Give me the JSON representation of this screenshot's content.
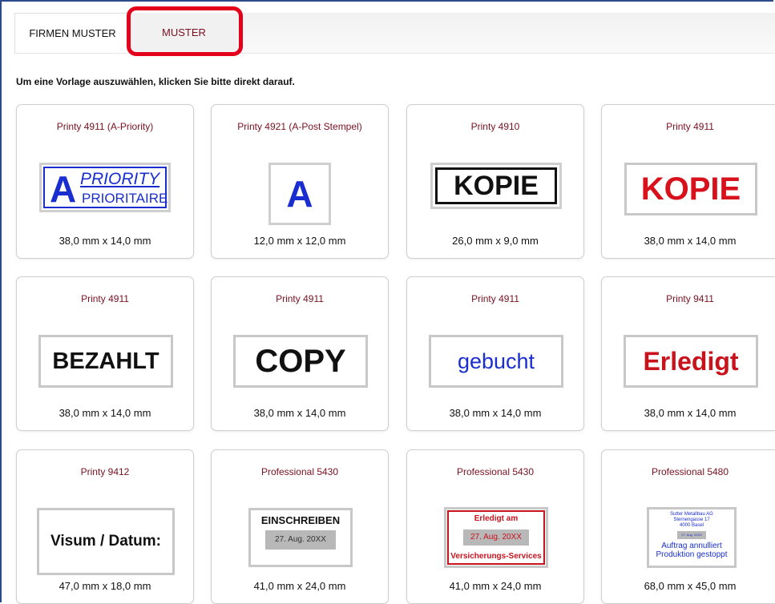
{
  "tabs": [
    {
      "label": "FIRMEN MUSTER"
    },
    {
      "label": "MUSTER"
    }
  ],
  "hint": "Um eine Vorlage auszuwählen, klicken Sie bitte direkt darauf.",
  "colors": {
    "accent": "#7a1020",
    "highlight": "#e4001b",
    "frame": "#2b4a8c",
    "blue": "#1a2ed0",
    "red": "#d8121c"
  },
  "cards": [
    {
      "title": "Printy 4911 (A-Priority)",
      "size": "38,0 mm x 14,0 mm",
      "stamp": {
        "big": "A",
        "line1": "PRIORITY",
        "line2": "PRIORITAIRE"
      }
    },
    {
      "title": "Printy 4921 (A-Post Stempel)",
      "size": "12,0 mm x 12,0 mm",
      "stamp": {
        "text": "A"
      }
    },
    {
      "title": "Printy 4910",
      "size": "26,0 mm x 9,0 mm",
      "stamp": {
        "text": "KOPIE"
      }
    },
    {
      "title": "Printy 4911",
      "size": "38,0 mm x 14,0 mm",
      "stamp": {
        "text": "KOPIE"
      }
    },
    {
      "title": "Printy 4911",
      "size": "38,0 mm x 14,0 mm",
      "stamp": {
        "text": "BEZAHLT"
      }
    },
    {
      "title": "Printy 4911",
      "size": "38,0 mm x 14,0 mm",
      "stamp": {
        "text": "COPY"
      }
    },
    {
      "title": "Printy 4911",
      "size": "38,0 mm x 14,0 mm",
      "stamp": {
        "text": "gebucht"
      }
    },
    {
      "title": "Printy 9411",
      "size": "38,0 mm x 14,0 mm",
      "stamp": {
        "text": "Erledigt"
      }
    },
    {
      "title": "Printy 9412",
      "size": "47,0 mm x 18,0 mm",
      "stamp": {
        "text": "Visum / Datum:"
      }
    },
    {
      "title": "Professional 5430",
      "size": "41,0 mm x 24,0 mm",
      "stamp": {
        "line1": "EINSCHREIBEN",
        "date": "27. Aug. 20XX"
      }
    },
    {
      "title": "Professional 5430",
      "size": "41,0 mm x 24,0 mm",
      "stamp": {
        "line1": "Erledigt am",
        "date": "27. Aug. 20XX",
        "line2": "Versicherungs-Services"
      }
    },
    {
      "title": "Professional 5480",
      "size": "68,0 mm x 45,0 mm",
      "stamp": {
        "addr1": "Sutter Metallbau AG",
        "addr2": "Sternengasse 17",
        "addr3": "4000 Basel",
        "date": "27. Aug. 20XX",
        "line1": "Auftrag annulliert",
        "line2": "Produktion gestoppt"
      }
    }
  ]
}
